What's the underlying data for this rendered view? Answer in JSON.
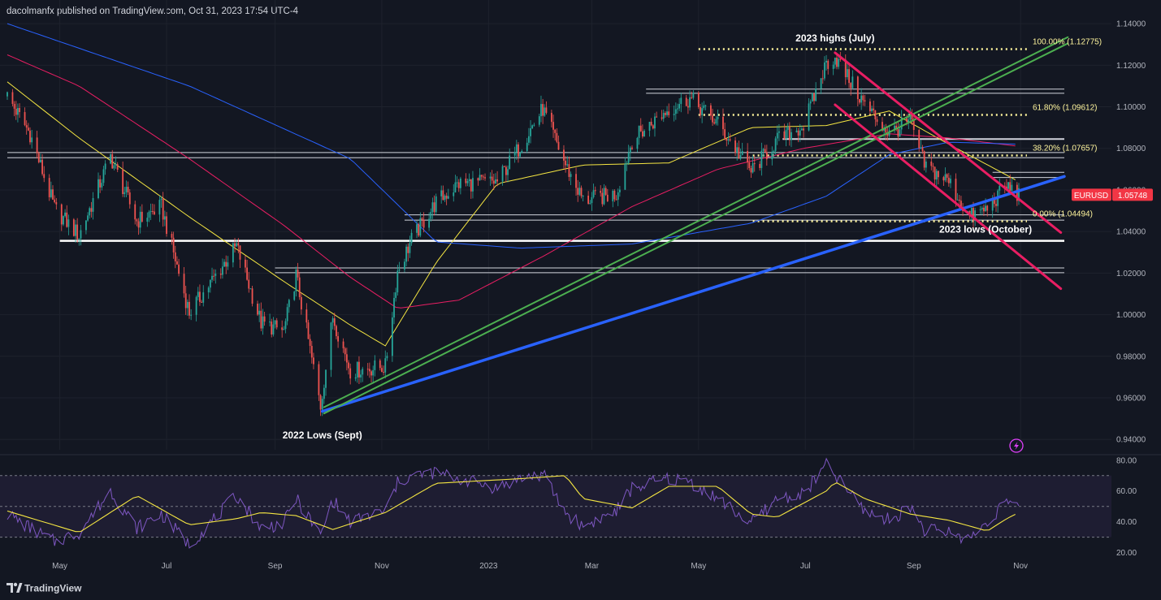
{
  "header": {
    "published_line": "dacolmanfx published on TradingView.com, Oct 31, 2023 17:54 UTC-4"
  },
  "footer": {
    "brand": "TradingView"
  },
  "colors": {
    "background": "#131722",
    "candle_up": "#26a69a",
    "candle_down": "#ef5350",
    "sma_yellow": "#f5e642",
    "sma_red": "#e91e63",
    "sma_blue": "#2962ff",
    "trend_blue": "#2962ff",
    "channel_pink": "#e91e63",
    "channel_green": "#4caf50",
    "price_tag": "#f23645",
    "fib_dots": "#fff59d",
    "rsi_line": "#7e57c2",
    "rsi_signal": "#f5e642"
  },
  "chart_data": [
    {
      "type": "candlestick",
      "symbol_label": "EURUSD",
      "last_price_label": "1.05748",
      "last_price": 1.05748,
      "x_tick_labels": [
        "May",
        "Jul",
        "Sep",
        "Nov",
        "2023",
        "Mar",
        "May",
        "Jul",
        "Sep",
        "Nov"
      ],
      "x_tick_dates": [
        "2022-05-01",
        "2022-07-01",
        "2022-09-01",
        "2022-11-01",
        "2023-01-01",
        "2023-03-01",
        "2023-05-01",
        "2023-07-01",
        "2023-09-01",
        "2023-11-01"
      ],
      "y_tick_labels": [
        "1.14000",
        "1.12000",
        "1.10000",
        "1.08000",
        "1.06000",
        "1.04000",
        "1.02000",
        "1.00000",
        "0.98000",
        "0.96000",
        "0.94000"
      ],
      "ylim": [
        0.935,
        1.142
      ],
      "close_waypoints": [
        [
          "2022-04-01",
          1.105
        ],
        [
          "2022-04-14",
          1.087
        ],
        [
          "2022-04-28",
          1.051
        ],
        [
          "2022-05-12",
          1.038
        ],
        [
          "2022-05-30",
          1.076
        ],
        [
          "2022-06-14",
          1.045
        ],
        [
          "2022-06-28",
          1.052
        ],
        [
          "2022-07-14",
          1.001
        ],
        [
          "2022-08-10",
          1.033
        ],
        [
          "2022-08-24",
          0.996
        ],
        [
          "2022-09-06",
          0.992
        ],
        [
          "2022-09-13",
          1.019
        ],
        [
          "2022-09-27",
          0.956
        ],
        [
          "2022-10-04",
          0.999
        ],
        [
          "2022-10-14",
          0.973
        ],
        [
          "2022-11-03",
          0.975
        ],
        [
          "2022-11-10",
          1.021
        ],
        [
          "2022-11-18",
          1.036
        ],
        [
          "2022-12-02",
          1.054
        ],
        [
          "2022-12-15",
          1.063
        ],
        [
          "2023-01-06",
          1.064
        ],
        [
          "2023-01-19",
          1.081
        ],
        [
          "2023-02-01",
          1.099
        ],
        [
          "2023-02-14",
          1.072
        ],
        [
          "2023-02-24",
          1.055
        ],
        [
          "2023-03-15",
          1.058
        ],
        [
          "2023-03-24",
          1.084
        ],
        [
          "2023-04-14",
          1.099
        ],
        [
          "2023-04-26",
          1.104
        ],
        [
          "2023-05-12",
          1.092
        ],
        [
          "2023-05-31",
          1.069
        ],
        [
          "2023-06-15",
          1.084
        ],
        [
          "2023-06-30",
          1.091
        ],
        [
          "2023-07-13",
          1.121
        ],
        [
          "2023-07-18",
          1.124
        ],
        [
          "2023-08-04",
          1.101
        ],
        [
          "2023-08-18",
          1.087
        ],
        [
          "2023-08-30",
          1.093
        ],
        [
          "2023-09-07",
          1.072
        ],
        [
          "2023-09-21",
          1.064
        ],
        [
          "2023-10-03",
          1.047
        ],
        [
          "2023-10-13",
          1.051
        ],
        [
          "2023-10-24",
          1.062
        ],
        [
          "2023-10-31",
          1.05748
        ]
      ],
      "moving_averages": [
        {
          "color": "sma_yellow",
          "points": [
            [
              "2022-04-01",
              1.112
            ],
            [
              "2022-05-12",
              1.085
            ],
            [
              "2022-07-14",
              1.047
            ],
            [
              "2022-09-06",
              1.016
            ],
            [
              "2022-10-14",
              0.995
            ],
            [
              "2022-11-03",
              0.985
            ],
            [
              "2022-12-02",
              1.025
            ],
            [
              "2023-01-06",
              1.063
            ],
            [
              "2023-02-24",
              1.072
            ],
            [
              "2023-04-14",
              1.073
            ],
            [
              "2023-05-31",
              1.09
            ],
            [
              "2023-07-13",
              1.091
            ],
            [
              "2023-08-18",
              1.098
            ],
            [
              "2023-09-21",
              1.082
            ],
            [
              "2023-10-31",
              1.064
            ]
          ]
        },
        {
          "color": "sma_red",
          "points": [
            [
              "2022-04-01",
              1.125
            ],
            [
              "2022-05-12",
              1.11
            ],
            [
              "2022-07-14",
              1.075
            ],
            [
              "2022-09-06",
              1.043
            ],
            [
              "2022-10-14",
              1.018
            ],
            [
              "2022-11-10",
              1.003
            ],
            [
              "2022-12-15",
              1.007
            ],
            [
              "2023-02-01",
              1.028
            ],
            [
              "2023-03-24",
              1.052
            ],
            [
              "2023-05-12",
              1.07
            ],
            [
              "2023-06-30",
              1.08
            ],
            [
              "2023-08-18",
              1.087
            ],
            [
              "2023-09-21",
              1.085
            ],
            [
              "2023-10-31",
              1.081
            ]
          ]
        },
        {
          "color": "sma_blue",
          "points": [
            [
              "2022-04-01",
              1.14
            ],
            [
              "2022-07-14",
              1.11
            ],
            [
              "2022-10-14",
              1.075
            ],
            [
              "2022-12-02",
              1.035
            ],
            [
              "2023-01-19",
              1.032
            ],
            [
              "2023-03-24",
              1.034
            ],
            [
              "2023-05-31",
              1.044
            ],
            [
              "2023-07-13",
              1.057
            ],
            [
              "2023-08-18",
              1.077
            ],
            [
              "2023-09-21",
              1.083
            ],
            [
              "2023-10-31",
              1.082
            ]
          ]
        }
      ],
      "trend_lines": [
        {
          "color": "trend_blue",
          "from": [
            "2022-09-28",
            0.9535
          ],
          "to": [
            "2023-11-26",
            1.0665
          ]
        },
        {
          "color": "channel_green",
          "from": [
            "2022-09-29",
            0.9555
          ],
          "to": [
            "2023-11-28",
            1.1335
          ]
        },
        {
          "color": "channel_green",
          "from": [
            "2022-09-29",
            0.9525
          ],
          "to": [
            "2023-11-28",
            1.1305
          ]
        },
        {
          "color": "channel_pink",
          "from": [
            "2023-07-18",
            1.126
          ],
          "to": [
            "2023-11-24",
            1.0395
          ]
        },
        {
          "color": "channel_pink",
          "from": [
            "2023-07-18",
            1.101
          ],
          "to": [
            "2023-11-24",
            1.0125
          ]
        }
      ],
      "horizontal_levels": [
        {
          "y": 1.1085,
          "from": "2023-04-01",
          "to": "2023-11-26",
          "style": "box-edge"
        },
        {
          "y": 1.1065,
          "from": "2023-04-01",
          "to": "2023-11-26",
          "style": "box-edge"
        },
        {
          "y": 1.078,
          "from": "2022-04-01",
          "to": "2023-11-26",
          "style": "box-edge"
        },
        {
          "y": 1.0755,
          "from": "2022-04-01",
          "to": "2023-11-26",
          "style": "box-edge"
        },
        {
          "y": 1.0845,
          "from": "2023-06-18",
          "to": "2023-11-26",
          "style": "solid"
        },
        {
          "y": 1.0685,
          "from": "2023-10-16",
          "to": "2023-11-26",
          "style": "box-edge"
        },
        {
          "y": 1.066,
          "from": "2023-10-16",
          "to": "2023-11-26",
          "style": "box-edge"
        },
        {
          "y": 1.048,
          "from": "2022-11-14",
          "to": "2023-11-26",
          "style": "box-edge"
        },
        {
          "y": 1.0455,
          "from": "2022-11-14",
          "to": "2023-11-26",
          "style": "box-edge"
        },
        {
          "y": 1.0355,
          "from": "2022-05-01",
          "to": "2023-11-26",
          "style": "solid-thick"
        },
        {
          "y": 1.0225,
          "from": "2022-09-01",
          "to": "2023-11-26",
          "style": "box-edge"
        },
        {
          "y": 1.0202,
          "from": "2022-09-01",
          "to": "2023-11-26",
          "style": "box-edge"
        }
      ],
      "fibonacci_levels": [
        {
          "label": "100.00% (1.12775)",
          "value": 1.12775,
          "from": "2023-05-01"
        },
        {
          "label": "61.80% (1.09612)",
          "value": 1.09612,
          "from": "2023-05-01"
        },
        {
          "label": "38.20% (1.07657)",
          "value": 1.07657,
          "from": "2023-06-01"
        },
        {
          "label": "0.00% (1.04494)",
          "value": 1.04494,
          "from": "2023-06-01"
        }
      ],
      "annotations": [
        {
          "text": "2023 highs (July)",
          "x": "2023-07-18",
          "y": 1.1315
        },
        {
          "text": "2023 lows (October)",
          "x": "2023-10-12",
          "y": 1.0395
        },
        {
          "text": "2022 Lows (Sept)",
          "x": "2022-09-28",
          "y": 0.9405
        }
      ]
    },
    {
      "type": "line",
      "indicator": "RSI",
      "y_tick_labels": [
        "80.00",
        "60.00",
        "40.00",
        "20.00"
      ],
      "ylim": [
        14,
        82
      ],
      "band": [
        30,
        70
      ],
      "midline": 50,
      "rsi_waypoints": [
        [
          "2022-04-01",
          45
        ],
        [
          "2022-04-14",
          36
        ],
        [
          "2022-04-28",
          27
        ],
        [
          "2022-05-12",
          33
        ],
        [
          "2022-05-30",
          60
        ],
        [
          "2022-06-14",
          36
        ],
        [
          "2022-06-28",
          45
        ],
        [
          "2022-07-14",
          25
        ],
        [
          "2022-08-10",
          57
        ],
        [
          "2022-08-24",
          36
        ],
        [
          "2022-09-06",
          39
        ],
        [
          "2022-09-13",
          55
        ],
        [
          "2022-09-27",
          31
        ],
        [
          "2022-10-04",
          54
        ],
        [
          "2022-10-14",
          40
        ],
        [
          "2022-11-03",
          47
        ],
        [
          "2022-11-10",
          65
        ],
        [
          "2022-11-18",
          70
        ],
        [
          "2022-12-02",
          72
        ],
        [
          "2022-12-15",
          68
        ],
        [
          "2023-01-06",
          62
        ],
        [
          "2023-01-19",
          68
        ],
        [
          "2023-02-01",
          71
        ],
        [
          "2023-02-14",
          46
        ],
        [
          "2023-02-24",
          37
        ],
        [
          "2023-03-15",
          47
        ],
        [
          "2023-03-24",
          62
        ],
        [
          "2023-04-14",
          68
        ],
        [
          "2023-04-26",
          66
        ],
        [
          "2023-05-12",
          55
        ],
        [
          "2023-05-31",
          39
        ],
        [
          "2023-06-15",
          55
        ],
        [
          "2023-06-30",
          58
        ],
        [
          "2023-07-13",
          77
        ],
        [
          "2023-07-18",
          70
        ],
        [
          "2023-08-04",
          47
        ],
        [
          "2023-08-18",
          41
        ],
        [
          "2023-08-30",
          50
        ],
        [
          "2023-09-07",
          35
        ],
        [
          "2023-09-21",
          33
        ],
        [
          "2023-10-03",
          29
        ],
        [
          "2023-10-13",
          40
        ],
        [
          "2023-10-24",
          54
        ],
        [
          "2023-10-31",
          47
        ]
      ],
      "signal_waypoints": [
        [
          "2022-04-01",
          47
        ],
        [
          "2022-05-12",
          33
        ],
        [
          "2022-06-14",
          57
        ],
        [
          "2022-07-14",
          38
        ],
        [
          "2022-08-10",
          42
        ],
        [
          "2022-08-24",
          46
        ],
        [
          "2022-09-13",
          44
        ],
        [
          "2022-10-04",
          35
        ],
        [
          "2022-11-03",
          46
        ],
        [
          "2022-12-02",
          65
        ],
        [
          "2023-01-19",
          68
        ],
        [
          "2023-02-14",
          70
        ],
        [
          "2023-02-24",
          55
        ],
        [
          "2023-03-24",
          49
        ],
        [
          "2023-04-14",
          63
        ],
        [
          "2023-05-12",
          63
        ],
        [
          "2023-05-31",
          45
        ],
        [
          "2023-06-15",
          43
        ],
        [
          "2023-07-13",
          60
        ],
        [
          "2023-07-18",
          66
        ],
        [
          "2023-08-04",
          55
        ],
        [
          "2023-08-30",
          45
        ],
        [
          "2023-09-21",
          41
        ],
        [
          "2023-10-13",
          34
        ],
        [
          "2023-10-24",
          42
        ],
        [
          "2023-10-31",
          46
        ]
      ]
    }
  ]
}
